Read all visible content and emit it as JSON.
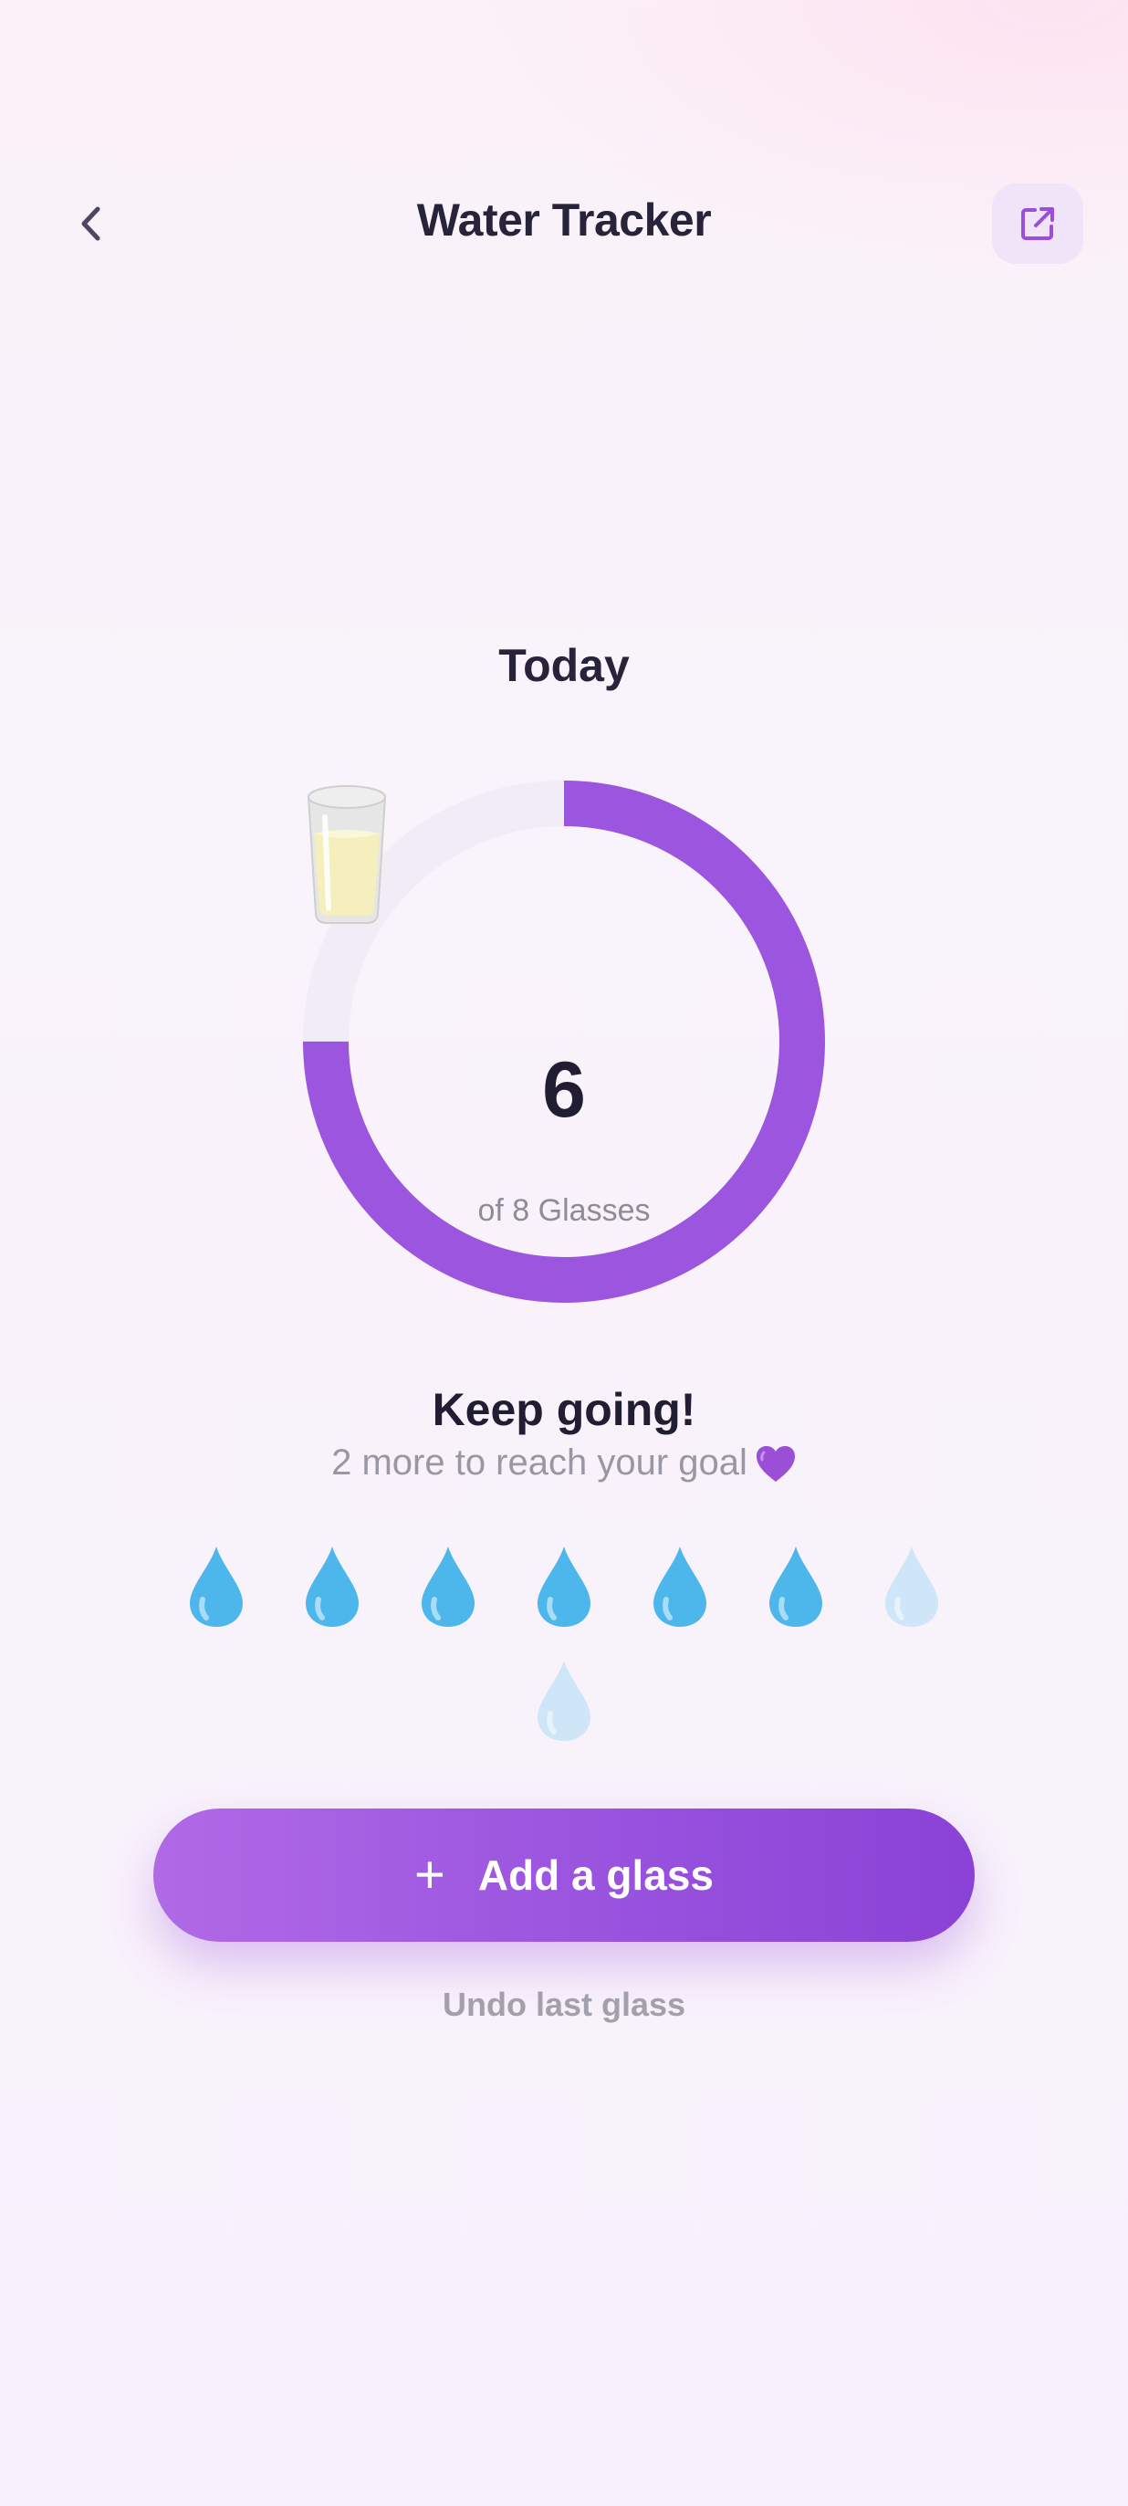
{
  "header": {
    "title": "Water Tracker",
    "back_icon": "chevron-left-icon",
    "share_icon": "external-link-icon"
  },
  "today": {
    "label": "Today",
    "count": "6",
    "goal_label": "of 8 Glasses",
    "consumed": 6,
    "goal": 8,
    "glass_icon": "glass-of-milk-icon"
  },
  "message": {
    "title": "Keep going!",
    "subtitle": "2 more to reach your goal",
    "emoji_icon": "purple-heart-icon"
  },
  "drops": [
    {
      "filled": true
    },
    {
      "filled": true
    },
    {
      "filled": true
    },
    {
      "filled": true
    },
    {
      "filled": true
    },
    {
      "filled": true
    },
    {
      "filled": false
    },
    {
      "filled": false
    }
  ],
  "actions": {
    "add_label": "Add a glass",
    "add_icon": "plus-icon",
    "undo_label": "Undo last glass"
  },
  "colors": {
    "accent": "#9b55df",
    "ring_track": "#f1edf6",
    "drop_filled": "#4db7ec",
    "drop_empty": "#cfe6f8"
  }
}
